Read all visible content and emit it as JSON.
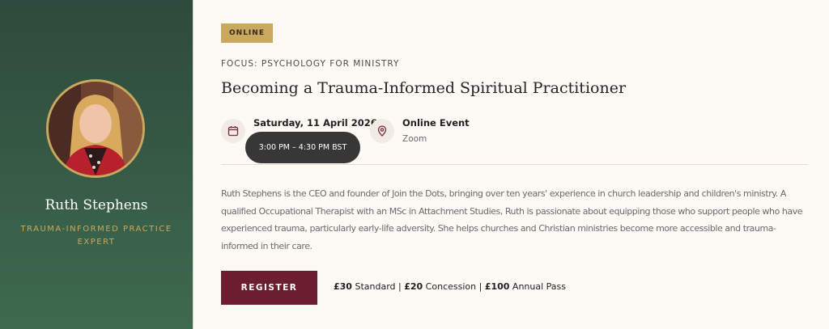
{
  "speaker": {
    "name": "Ruth Stephens",
    "role": "TRAUMA-INFORMED PRACTICE EXPERT"
  },
  "event": {
    "badge": "ONLINE",
    "focus": "FOCUS: PSYCHOLOGY FOR MINISTRY",
    "title": "Becoming a Trauma-Informed Spiritual Practitioner",
    "date": "Saturday, 11 April 2026",
    "time": "3:00 PM – 4:30 PM BST",
    "location_title": "Online Event",
    "location_sub": "Zoom",
    "description": "Ruth Stephens is the CEO and founder of Join the Dots, bringing over ten years' experience in church leadership and children's ministry. A qualified Occupational Therapist with an MSc in Attachment Studies, Ruth is passionate about equipping those who support people who have experienced trauma, particularly early-life adversity. She helps churches and Christian ministries become more accessible and trauma-informed in their care.",
    "register_label": "REGISTER",
    "pricing": {
      "standard_price": "£30",
      "standard_label": " Standard | ",
      "concession_price": "£20",
      "concession_label": " Concession | ",
      "annual_price": "£100",
      "annual_label": " Annual Pass"
    }
  },
  "icons": {
    "calendar": "calendar-icon",
    "location": "map-pin-icon"
  },
  "colors": {
    "sidebar_green": "#2e4a3c",
    "gold": "#c9a860",
    "burgundy": "#6b1f2e",
    "background": "#fdfaf6"
  }
}
